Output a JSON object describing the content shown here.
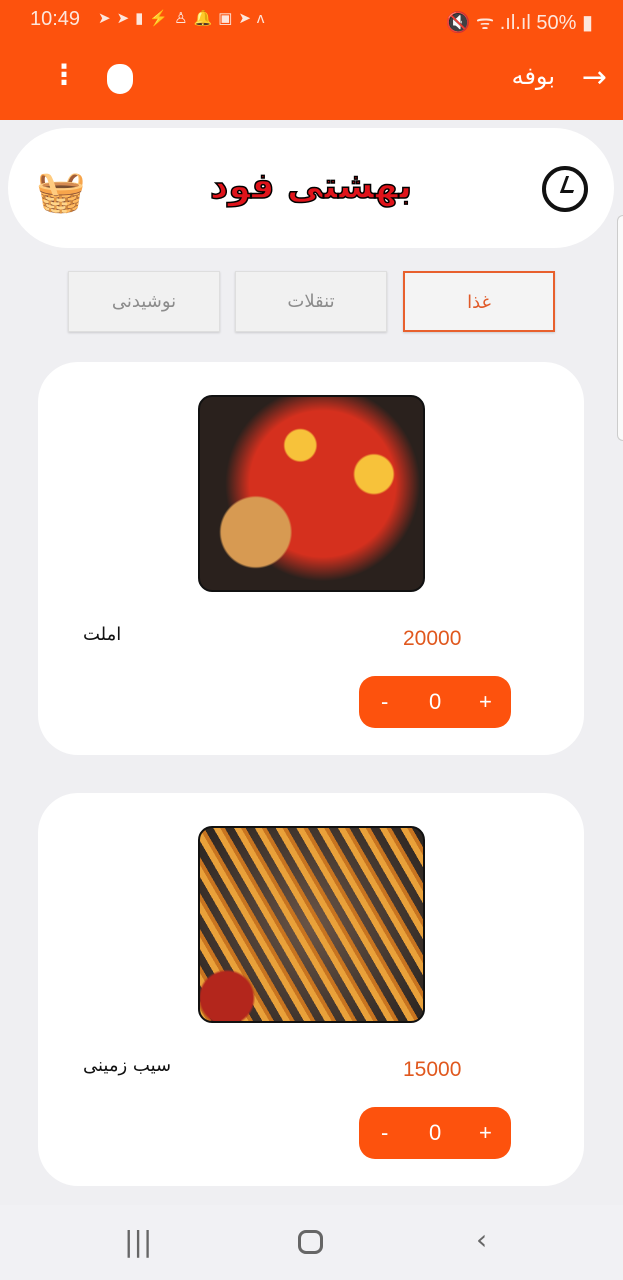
{
  "status": {
    "time": "10:49",
    "battery": "50%"
  },
  "appbar": {
    "title": "بوفه"
  },
  "header": {
    "brand": "بهشتی فود"
  },
  "tabs": [
    {
      "label": "غذا",
      "active": true
    },
    {
      "label": "تنقلات"
    },
    {
      "label": "نوشیدنی"
    }
  ],
  "items": [
    {
      "name": "املت",
      "price": "20000",
      "qty": "0",
      "minus": "-",
      "plus": "+"
    },
    {
      "name": "سیب زمینی",
      "price": "15000",
      "qty": "0",
      "minus": "-",
      "plus": "+"
    }
  ],
  "colors": {
    "accent": "#fd520d"
  }
}
